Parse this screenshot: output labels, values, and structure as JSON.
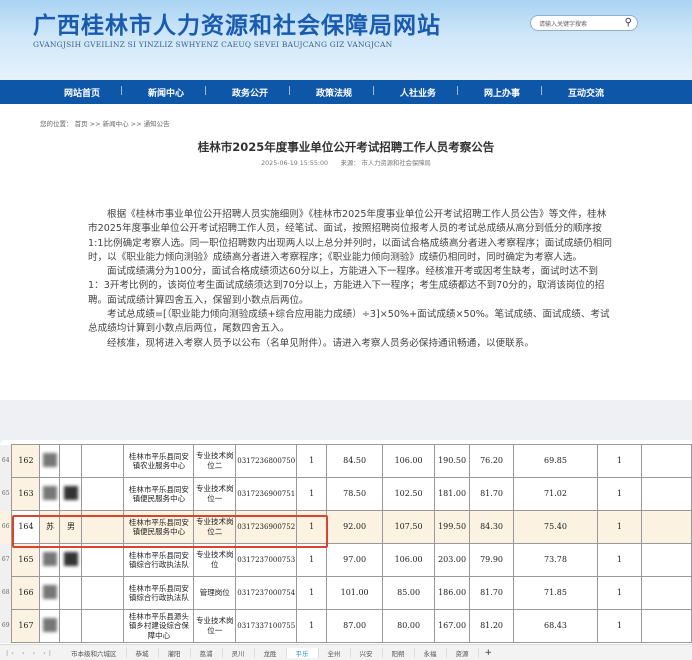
{
  "header": {
    "title": "广西桂林市人力资源和社会保障局网站",
    "subtitle": "GVANGJSIH GVEILINZ SI YINZLIZ SWHYENZ CAEUQ SEVEI BAUJCANG GIZ VANGJCAN",
    "search_placeholder": "请输入关键字搜索"
  },
  "nav": [
    "网站首页",
    "新闻中心",
    "政务公开",
    "政策法规",
    "人社业务",
    "网上办事",
    "互动交流"
  ],
  "breadcrumb": "您的位置： 首页 >> 新闻中心 >> 通知公告",
  "article": {
    "title": "桂林市2025年度事业单位公开考试招聘工作人员考察公告",
    "meta": "2025-06-19 15:55:00　　来源： 市人力资源和社会保障局",
    "paragraphs": [
      "根据《桂林市事业单位公开招聘人员实施细则》《桂林市2025年度事业单位公开考试招聘工作人员公告》等文件，桂林市2025年度事业单位公开考试招聘工作人员，经笔试、面试，按照招聘岗位报考人员的考试总成绩从高分到低分的顺序按1:1比例确定考察人选。同一职位招聘数内出现两人以上总分并列时，以面试合格成绩高分者进入考察程序；面试成绩仍相同时，以《职业能力倾向测验》成绩高分者进入考察程序；《职业能力倾向测验》成绩仍相同时，同时确定为考察人选。",
      "面试成绩满分为100分，面试合格成绩须达60分以上，方能进入下一程序。经核准开考或因考生缺考，面试时达不到1：3开考比例的，该岗位考生面试成绩须达到70分以上，方能进入下一程序；考生成绩都达不到70分的，取消该岗位的招聘。面试成绩计算四舍五入，保留到小数点后两位。",
      "考试总成绩=[（职业能力倾向测验成绩+综合应用能力成绩）÷3]×50%+面试成绩×50%。笔试成绩、面试成绩、考试总成绩均计算到小数点后两位，尾数四舍五入。",
      "经核准，现将进入考察人员予以公布（名单见附件）。请进入考察人员务必保持通讯畅通，以便联系。"
    ]
  },
  "table": {
    "rows": [
      {
        "rownum": "64",
        "seq": "162",
        "name": "",
        "sex": "",
        "unit": "桂林市平乐县同安镇农业服务中心",
        "post": "专业技术岗位二",
        "code": "0317236800750",
        "count": "1",
        "s1": "84.50",
        "s2": "106.00",
        "sum": "190.50",
        "interview": "76.20",
        "total": "69.85",
        "rank": "1"
      },
      {
        "rownum": "65",
        "seq": "163",
        "name": "",
        "sex": "",
        "unit": "桂林市平乐县同安镇便民服务中心",
        "post": "专业技术岗位一",
        "code": "0317236900751",
        "count": "1",
        "s1": "78.50",
        "s2": "102.50",
        "sum": "181.00",
        "interview": "81.70",
        "total": "71.02",
        "rank": "1"
      },
      {
        "rownum": "66",
        "seq": "164",
        "name": "苏",
        "sex": "男",
        "unit": "桂林市平乐县同安镇便民服务中心",
        "post": "专业技术岗位二",
        "code": "0317236900752",
        "count": "1",
        "s1": "92.00",
        "s2": "107.50",
        "sum": "199.50",
        "interview": "84.30",
        "total": "75.40",
        "rank": "1"
      },
      {
        "rownum": "67",
        "seq": "165",
        "name": "",
        "sex": "",
        "unit": "桂林市平乐县同安镇综合行政执法队",
        "post": "专业技术岗位",
        "code": "0317237000753",
        "count": "1",
        "s1": "97.00",
        "s2": "106.00",
        "sum": "203.00",
        "interview": "79.90",
        "total": "73.78",
        "rank": "1"
      },
      {
        "rownum": "68",
        "seq": "166",
        "name": "",
        "sex": "",
        "unit": "桂林市平乐县同安镇综合行政执法队",
        "post": "管理岗位",
        "code": "0317237000754",
        "count": "1",
        "s1": "101.00",
        "s2": "85.00",
        "sum": "186.00",
        "interview": "81.70",
        "total": "71.85",
        "rank": "1"
      },
      {
        "rownum": "69",
        "seq": "167",
        "name": "",
        "sex": "",
        "unit": "桂林市平乐县源头镇乡村建设综合保障中心",
        "post": "专业技术岗位一",
        "code": "0317337100755",
        "count": "1",
        "s1": "87.00",
        "s2": "80.00",
        "sum": "167.00",
        "interview": "81.20",
        "total": "68.43",
        "rank": "1"
      }
    ]
  },
  "sheet_tabs": [
    "市本级和六城区",
    "恭城",
    "灌阳",
    "荔浦",
    "灵川",
    "龙胜",
    "平乐",
    "全州",
    "兴安",
    "阳朔",
    "永福",
    "资源"
  ],
  "active_tab": "平乐"
}
